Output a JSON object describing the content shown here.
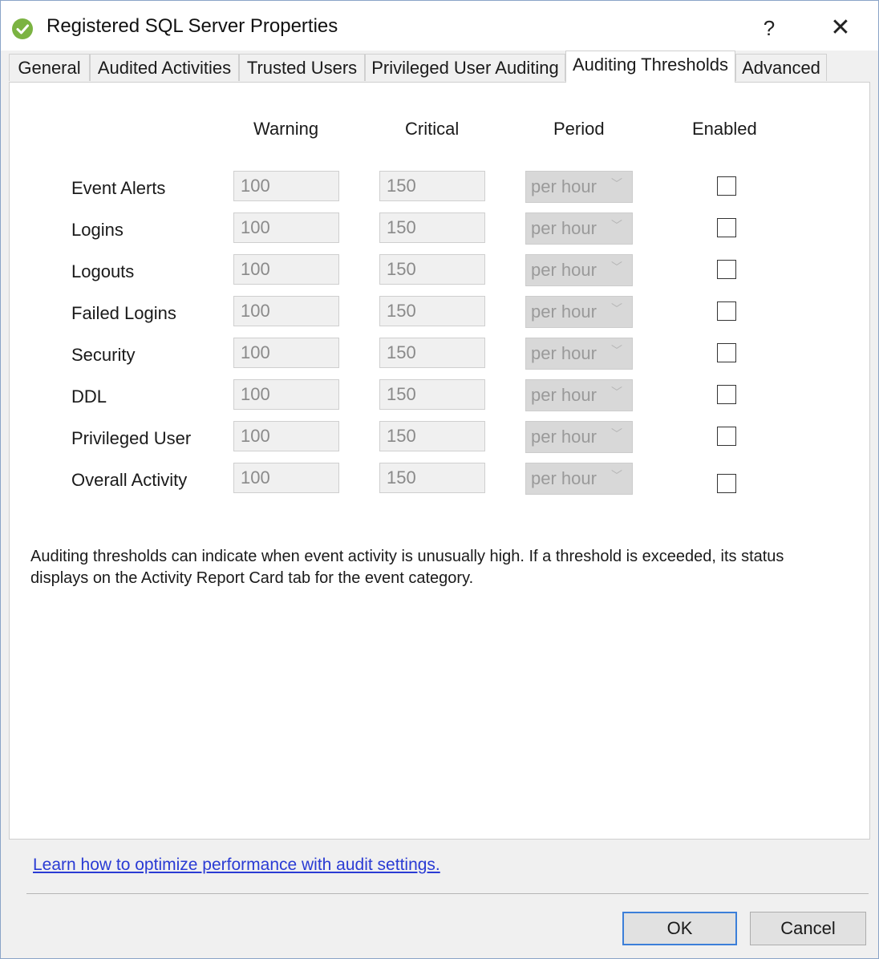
{
  "window": {
    "title": "Registered SQL Server Properties",
    "help_label": "?",
    "close_label": "✕"
  },
  "tabs": [
    {
      "label": "General",
      "active": false
    },
    {
      "label": "Audited Activities",
      "active": false
    },
    {
      "label": "Trusted Users",
      "active": false
    },
    {
      "label": "Privileged User Auditing",
      "active": false
    },
    {
      "label": "Auditing Thresholds",
      "active": true
    },
    {
      "label": "Advanced",
      "active": false
    }
  ],
  "columns": {
    "warning": "Warning",
    "critical": "Critical",
    "period": "Period",
    "enabled": "Enabled"
  },
  "rows": [
    {
      "label": "Event Alerts",
      "warning": "100",
      "critical": "150",
      "period": "per hour",
      "enabled": false
    },
    {
      "label": "Logins",
      "warning": "100",
      "critical": "150",
      "period": "per hour",
      "enabled": false
    },
    {
      "label": "Logouts",
      "warning": "100",
      "critical": "150",
      "period": "per hour",
      "enabled": false
    },
    {
      "label": "Failed Logins",
      "warning": "100",
      "critical": "150",
      "period": "per hour",
      "enabled": false
    },
    {
      "label": "Security",
      "warning": "100",
      "critical": "150",
      "period": "per hour",
      "enabled": false
    },
    {
      "label": "DDL",
      "warning": "100",
      "critical": "150",
      "period": "per hour",
      "enabled": false
    },
    {
      "label": "Privileged User",
      "warning": "100",
      "critical": "150",
      "period": "per hour",
      "enabled": false
    },
    {
      "label": "Overall Activity",
      "warning": "100",
      "critical": "150",
      "period": "per hour",
      "enabled": false
    }
  ],
  "description": "Auditing thresholds can indicate when event activity is unusually high. If a threshold is exceeded, its status displays on the Activity Report Card tab for the event category.",
  "footer": {
    "link_text": "Learn how to optimize performance with audit settings.",
    "ok_label": "OK",
    "cancel_label": "Cancel"
  },
  "icons": {
    "app": "check-circle-icon",
    "dropdown": "chevron-down-icon"
  },
  "colors": {
    "accent": "#3c7fd9",
    "app_icon": "#7bb342",
    "link": "#2a3bd4"
  }
}
